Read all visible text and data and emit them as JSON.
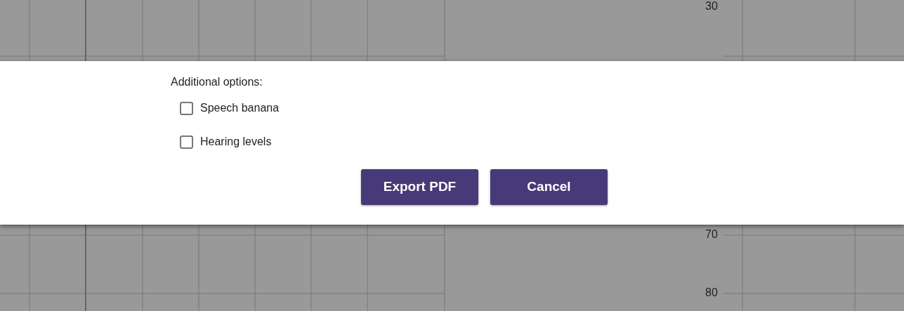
{
  "chart_background": {
    "tick_labels": [
      "30",
      "70",
      "80"
    ]
  },
  "dialog": {
    "heading": "Additional options:",
    "options": [
      {
        "label": "Speech banana",
        "checked": false
      },
      {
        "label": "Hearing levels",
        "checked": false
      }
    ],
    "buttons": [
      {
        "label": "Export PDF"
      },
      {
        "label": "Cancel"
      }
    ]
  }
}
